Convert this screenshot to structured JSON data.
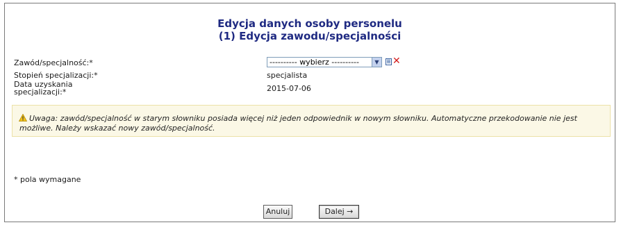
{
  "header": {
    "title_line1": "Edycja danych osoby personelu",
    "title_line2": "(1) Edycja zawodu/specjalności"
  },
  "form": {
    "profession_label": "Zawód/specjalność:*",
    "profession_select_value": "---------- wybierz ----------",
    "degree_label": "Stopień specjalizacji:*",
    "degree_value": "specjalista",
    "date_label_line1": "Data uzyskania",
    "date_label_line2": "specjalizacji:*",
    "date_value": "2015-07-06"
  },
  "warning": {
    "text": "Uwaga: zawód/specjalność w starym słowniku posiada więcej niż jeden odpowiednik w nowym słowniku. Automatyczne przekodowanie nie jest możliwe. Należy wskazać nowy zawód/specjalność."
  },
  "footer": {
    "required_note": "* pola wymagane",
    "cancel_label": "Anuluj",
    "next_label": "Dalej →"
  },
  "icons": {
    "select_arrow": "chevron-down-icon",
    "list": "list-icon",
    "clear": "close-icon",
    "warning": "warning-icon"
  },
  "colors": {
    "title": "#1f2a82",
    "warning_bg": "#fbf8e6",
    "warning_border": "#ece1a8",
    "clear_icon": "#d21b1b"
  }
}
